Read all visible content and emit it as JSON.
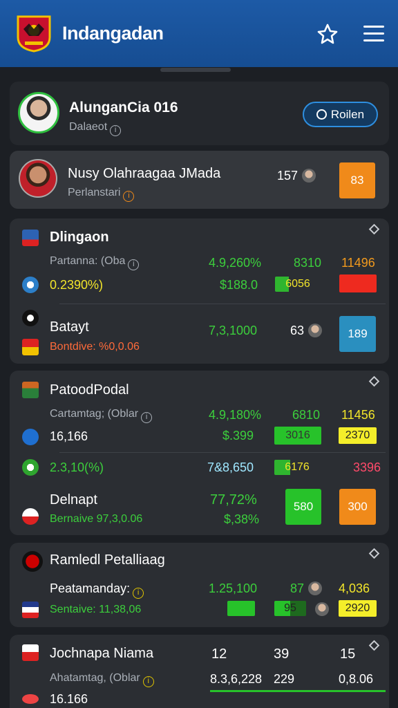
{
  "header": {
    "title": "Indangadan",
    "icons": [
      "emblem-logo",
      "star-icon",
      "menu-icon"
    ]
  },
  "profile": {
    "name": "AlunganCia 016",
    "subtitle": "Dalaeot",
    "button": "Roilen"
  },
  "featured": {
    "name": "Nusy Olahraagaa JMada",
    "subtitle": "Perlanstari",
    "count": "157",
    "score": "83"
  },
  "group1": {
    "title": "Dlingaon",
    "meta": "Partanna: (Oba",
    "v1": "4.9,260%",
    "v2": "8310",
    "v3": "11496",
    "pct": "0.2390%)",
    "money": "$188.0",
    "bar_val": "6056",
    "row2_title": "Batayt",
    "row2_meta": "Bontdive: %0,0.06",
    "row2_val": "7,3,1000",
    "row2_count": "63",
    "row2_badge": "189"
  },
  "group2": {
    "title": "PatoodPodal",
    "meta": "Cartamtag; (Oblar",
    "v1": "4.9,180%",
    "v2": "6810",
    "v3": "11456",
    "num": "16,166",
    "money": "$.399",
    "bar1": "3016",
    "bar2": "2370",
    "pct": "2.3,10(%)",
    "v4": "7&8,650",
    "bar3": "6176",
    "v5": "3396",
    "row_title": "Delnapt",
    "row_meta": "Bernaive 97,3,0.06",
    "row_pct": "77,72%",
    "row_money": "$,38%",
    "badge1": "580",
    "badge2": "300"
  },
  "group3": {
    "title": "Ramledl Petalliaag",
    "meta": "Peatamanday:",
    "v1": "1.25,100",
    "v2": "87",
    "v3": "4,036",
    "row_meta": "Sentaive: 11,38,06",
    "bar_val": "95",
    "badge": "2920"
  },
  "group4": {
    "title": "Jochnapa Niama",
    "n1": "12",
    "n2": "39",
    "n3": "15",
    "meta": "Ahatamtag, (Oblar",
    "v1": "8.3,6,228",
    "v2": "229",
    "v3": "0,8.06",
    "last": "16.166"
  }
}
